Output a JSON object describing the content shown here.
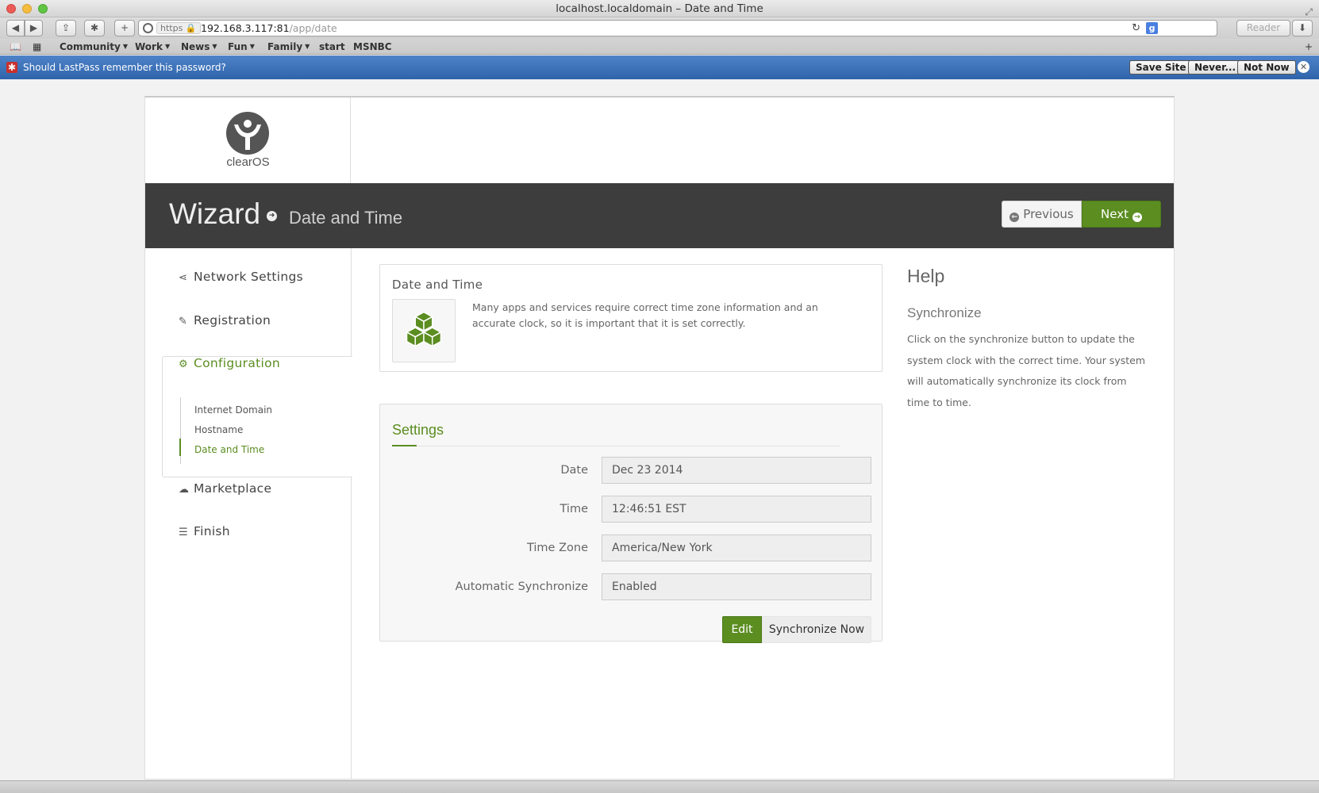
{
  "browser": {
    "window_title": "localhost.localdomain – Date and Time",
    "url_scheme": "https",
    "url_host": "192.168.3.117:81",
    "url_path": "/app/date",
    "reader_label": "Reader",
    "bookmarks": [
      {
        "label": "Community",
        "dropdown": true
      },
      {
        "label": "Work",
        "dropdown": true
      },
      {
        "label": "News",
        "dropdown": true
      },
      {
        "label": "Fun",
        "dropdown": true
      },
      {
        "label": "Family",
        "dropdown": true
      },
      {
        "label": "start",
        "dropdown": false
      },
      {
        "label": "MSNBC",
        "dropdown": false
      }
    ]
  },
  "lastpass": {
    "message": "Should LastPass remember this password?",
    "save_site": "Save Site",
    "never": "Never...",
    "not_now": "Not Now"
  },
  "logo": {
    "text": "clearOS"
  },
  "banner": {
    "title": "Wizard",
    "subtitle": "Date and Time",
    "previous_label": "Previous",
    "next_label": "Next"
  },
  "sidebar": {
    "items": [
      {
        "label": "Network Settings",
        "icon": "share-icon"
      },
      {
        "label": "Registration",
        "icon": "pencil-icon"
      },
      {
        "label": "Configuration",
        "icon": "cogs-icon"
      },
      {
        "label": "Marketplace",
        "icon": "cloud-download-icon"
      },
      {
        "label": "Finish",
        "icon": "list-icon"
      }
    ],
    "subitems": [
      "Internet Domain",
      "Hostname",
      "Date and Time"
    ]
  },
  "intro_card": {
    "title": "Date and Time",
    "description": "Many apps and services require correct time zone information and an accurate clock, so it is important that it is set correctly."
  },
  "settings": {
    "title": "Settings",
    "fields": [
      {
        "label": "Date",
        "value": "Dec 23 2014"
      },
      {
        "label": "Time",
        "value": "12:46:51 EST"
      },
      {
        "label": "Time Zone",
        "value": "America/New York"
      },
      {
        "label": "Automatic Synchronize",
        "value": "Enabled"
      }
    ],
    "edit_label": "Edit",
    "sync_label": "Synchronize Now"
  },
  "help": {
    "title": "Help",
    "subtitle": "Synchronize",
    "text": "Click on the synchronize button to update the system clock with the correct time. Your system will automatically synchronize its clock from time to time."
  },
  "colors": {
    "accent_green": "#5b8d21",
    "banner_dark": "#3d3d3d",
    "lastpass_blue": "#3b6fb6"
  }
}
